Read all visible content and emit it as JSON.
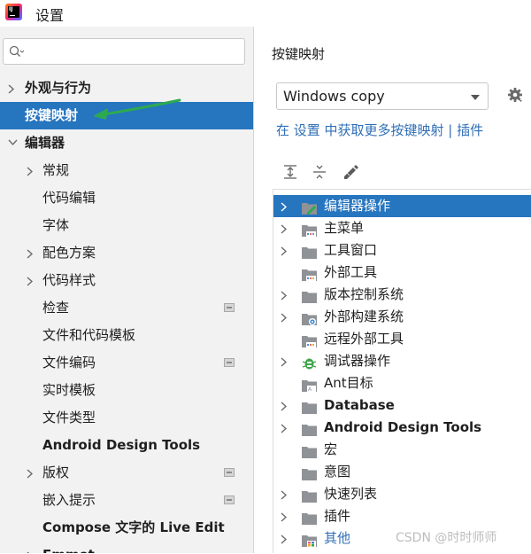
{
  "window": {
    "title": "设置",
    "logo_text": "IJ"
  },
  "search": {
    "placeholder": ""
  },
  "sidebar": {
    "items": [
      {
        "label": "外观与行为",
        "bold": true,
        "chevron": "right",
        "indent": 0
      },
      {
        "label": "按键映射",
        "bold": true,
        "chevron": "none",
        "indent": 0,
        "selected": true
      },
      {
        "label": "编辑器",
        "bold": true,
        "chevron": "down",
        "indent": 0
      },
      {
        "label": "常规",
        "chevron": "right",
        "indent": 1
      },
      {
        "label": "代码编辑",
        "chevron": "none",
        "indent": 1
      },
      {
        "label": "字体",
        "chevron": "none",
        "indent": 1
      },
      {
        "label": "配色方案",
        "chevron": "right",
        "indent": 1
      },
      {
        "label": "代码样式",
        "chevron": "right",
        "indent": 1
      },
      {
        "label": "检查",
        "chevron": "none",
        "indent": 1,
        "project_icon": true
      },
      {
        "label": "文件和代码模板",
        "chevron": "none",
        "indent": 1
      },
      {
        "label": "文件编码",
        "chevron": "none",
        "indent": 1,
        "project_icon": true
      },
      {
        "label": "实时模板",
        "chevron": "none",
        "indent": 1
      },
      {
        "label": "文件类型",
        "chevron": "none",
        "indent": 1
      },
      {
        "label": "Android Design Tools",
        "bold": true,
        "chevron": "none",
        "indent": 1
      },
      {
        "label": "版权",
        "chevron": "right",
        "indent": 1,
        "project_icon": true
      },
      {
        "label": "嵌入提示",
        "chevron": "none",
        "indent": 1,
        "project_icon": true
      },
      {
        "label": "Compose 文字的 Live Edit",
        "bold": true,
        "chevron": "none",
        "indent": 1
      },
      {
        "label": "Emmet",
        "bold": true,
        "chevron": "right",
        "indent": 1
      }
    ]
  },
  "keymap": {
    "title": "按键映射",
    "selected_keymap": "Windows copy",
    "link_text": "在 设置 中获取更多按键映射 | 插件",
    "tree": [
      {
        "label": "编辑器操作",
        "icon": "editor-actions-icon",
        "chevron": true,
        "selected": true
      },
      {
        "label": "主菜单",
        "icon": "folder-menu-icon",
        "chevron": true
      },
      {
        "label": "工具窗口",
        "icon": "folder-icon",
        "chevron": true
      },
      {
        "label": "外部工具",
        "icon": "folder-tools-icon",
        "chevron": false
      },
      {
        "label": "版本控制系统",
        "icon": "folder-icon",
        "chevron": true
      },
      {
        "label": "外部构建系统",
        "icon": "folder-gear-icon",
        "chevron": true
      },
      {
        "label": "远程外部工具",
        "icon": "folder-tools-icon",
        "chevron": false
      },
      {
        "label": "调试器操作",
        "icon": "bug-icon",
        "chevron": true
      },
      {
        "label": "Ant目标",
        "icon": "folder-ant-icon",
        "chevron": false
      },
      {
        "label": "Database",
        "icon": "folder-icon",
        "chevron": true,
        "bold": true
      },
      {
        "label": "Android Design Tools",
        "icon": "folder-icon",
        "chevron": true,
        "bold": true
      },
      {
        "label": "宏",
        "icon": "folder-icon",
        "chevron": false
      },
      {
        "label": "意图",
        "icon": "folder-icon",
        "chevron": false
      },
      {
        "label": "快速列表",
        "icon": "folder-icon",
        "chevron": true
      },
      {
        "label": "插件",
        "icon": "folder-icon",
        "chevron": true
      },
      {
        "label": "其他",
        "icon": "folder-other-icon",
        "chevron": true,
        "link": true
      }
    ]
  },
  "watermark": "CSDN @时时师师",
  "colors": {
    "selection": "#2675bf",
    "link": "#2f6fb7",
    "arrow": "#2daa4f"
  }
}
